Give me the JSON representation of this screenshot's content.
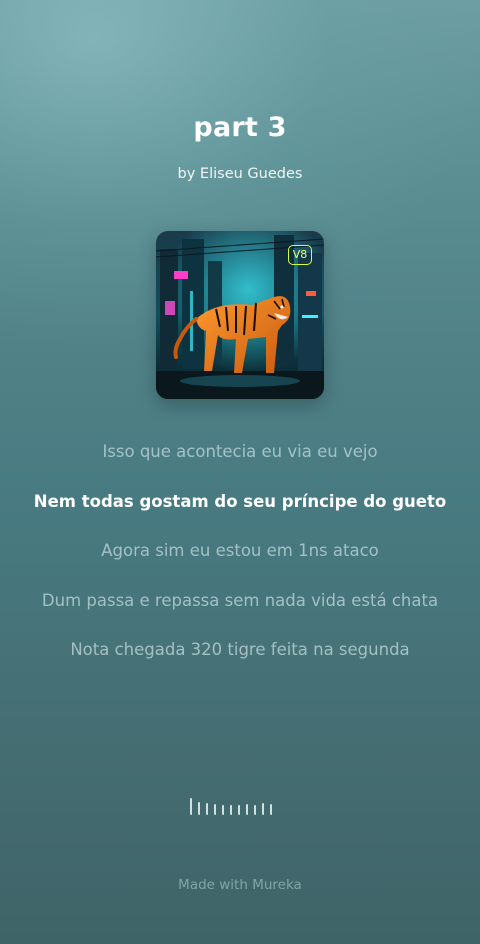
{
  "song": {
    "title": "part 3",
    "author": "by Eliseu Guedes"
  },
  "cover": {
    "badge": "V8",
    "icon": "tiger-cover-art"
  },
  "lyrics": [
    "Isso que acontecia eu via eu vejo",
    "Nem todas gostam do seu príncipe do gueto",
    "Agora sim eu estou em 1ns ataco",
    "Dum passa e repassa sem nada vida está chata",
    "Nota chegada 320 tigre feita na segunda"
  ],
  "active_lyric_index": 1,
  "footer": "Made with Mureka",
  "colors": {
    "active_lyric": "#ffffff",
    "inactive_lyric": "#bed6d8",
    "badge": "#d9ff3a"
  }
}
